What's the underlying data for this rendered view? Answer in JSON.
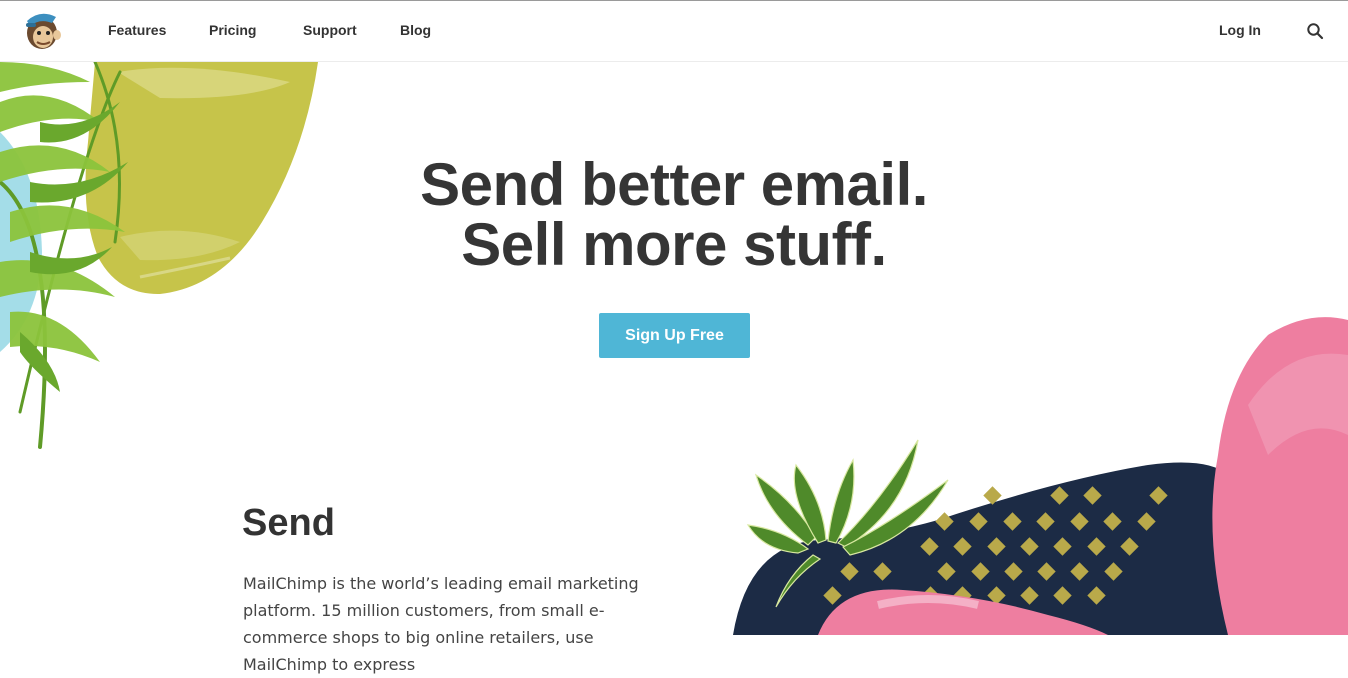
{
  "nav": {
    "logo_icon": "freddie-monkey-logo-icon",
    "links": [
      "Features",
      "Pricing",
      "Support",
      "Blog"
    ],
    "login": "Log In",
    "search_icon": "search-icon"
  },
  "hero": {
    "title_line1": "Send better email.",
    "title_line2": "Sell more stuff.",
    "cta_label": "Sign Up Free"
  },
  "section": {
    "title": "Send",
    "body": "MailChimp is the world’s leading email marketing platform. 15 million customers, from small e-commerce shops to big online retailers, use MailChimp to express"
  },
  "colors": {
    "cta": "#4fb6d6",
    "heading": "#353535",
    "yellow_blob": "#c6c44a",
    "pink_blob": "#ee7ea0",
    "navy_blob": "#1c2b45",
    "diamond": "#b9a94a"
  }
}
